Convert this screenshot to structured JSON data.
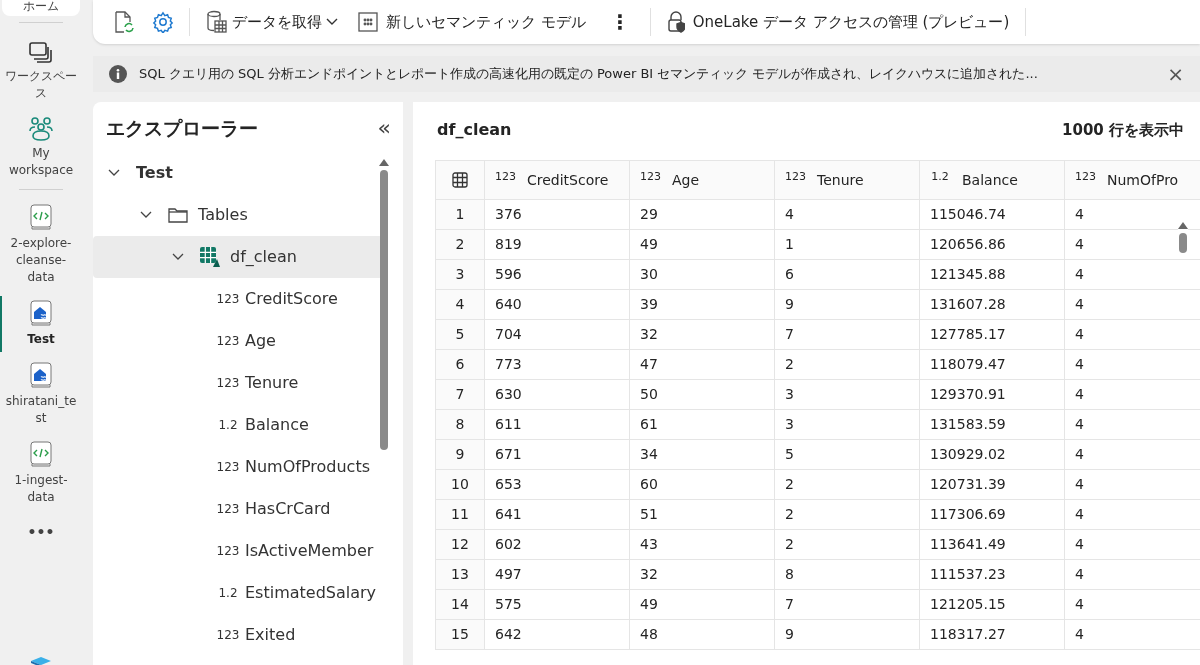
{
  "nav_rail": {
    "top_label": "ホーム",
    "items": [
      {
        "kind": "workspaces",
        "label": "ワークスペース",
        "selected": false
      },
      {
        "kind": "my_workspace",
        "label": "My workspace",
        "selected": false
      },
      {
        "kind": "notebook",
        "label": "2-explore-cleanse-data",
        "selected": false
      },
      {
        "kind": "lakehouse",
        "label": "Test",
        "selected": true
      },
      {
        "kind": "lakehouse",
        "label": "shiratani_test",
        "selected": false
      },
      {
        "kind": "notebook",
        "label": "1-ingest-data",
        "selected": false
      }
    ],
    "more": "•••"
  },
  "toolbar": {
    "items": [
      {
        "kind": "refresh"
      },
      {
        "kind": "settings"
      },
      {
        "kind": "get_data",
        "label": "データを取得"
      },
      {
        "kind": "semantic_model",
        "label": "新しいセマンティック モデル"
      },
      {
        "kind": "more",
        "label": "⋮"
      },
      {
        "kind": "access",
        "label": "OneLake データ アクセスの管理 (プレビュー)"
      }
    ]
  },
  "info_bar": {
    "message": "SQL クエリ用の SQL 分析エンドポイントとレポート作成の高速化用の既定の Power BI セマンティック モデルが作成され、レイクハウスに追加された...",
    "close": "×"
  },
  "explorer": {
    "title": "エクスプローラー",
    "collapse": "«",
    "tree": [
      {
        "label": "Test",
        "kind": "root",
        "expanded": true,
        "selected": false,
        "children": [
          {
            "label": "Tables",
            "kind": "folder",
            "expanded": true,
            "selected": false,
            "children": [
              {
                "label": "df_clean",
                "kind": "table",
                "expanded": true,
                "selected": true,
                "children": [
                  {
                    "label": "CreditScore",
                    "kind": "column",
                    "type_label": "123"
                  },
                  {
                    "label": "Age",
                    "kind": "column",
                    "type_label": "123"
                  },
                  {
                    "label": "Tenure",
                    "kind": "column",
                    "type_label": "123"
                  },
                  {
                    "label": "Balance",
                    "kind": "column",
                    "type_label": "1.2"
                  },
                  {
                    "label": "NumOfProducts",
                    "kind": "column",
                    "type_label": "123"
                  },
                  {
                    "label": "HasCrCard",
                    "kind": "column",
                    "type_label": "123"
                  },
                  {
                    "label": "IsActiveMember",
                    "kind": "column",
                    "type_label": "123"
                  },
                  {
                    "label": "EstimatedSalary",
                    "kind": "column",
                    "type_label": "1.2"
                  },
                  {
                    "label": "Exited",
                    "kind": "column",
                    "type_label": "123"
                  }
                ]
              }
            ]
          }
        ]
      }
    ]
  },
  "preview": {
    "title": "df_clean",
    "row_count": "1000 行を表示中",
    "columns": [
      {
        "type_label": "123",
        "name": "CreditScore"
      },
      {
        "type_label": "123",
        "name": "Age"
      },
      {
        "type_label": "123",
        "name": "Tenure"
      },
      {
        "type_label": "1.2",
        "name": "Balance"
      },
      {
        "type_label": "123",
        "name": "NumOfPro"
      }
    ],
    "rows": [
      {
        "number": "1",
        "cells": [
          "376",
          "29",
          "4",
          "115046.74",
          "4"
        ]
      },
      {
        "number": "2",
        "cells": [
          "819",
          "49",
          "1",
          "120656.86",
          "4"
        ]
      },
      {
        "number": "3",
        "cells": [
          "596",
          "30",
          "6",
          "121345.88",
          "4"
        ]
      },
      {
        "number": "4",
        "cells": [
          "640",
          "39",
          "9",
          "131607.28",
          "4"
        ]
      },
      {
        "number": "5",
        "cells": [
          "704",
          "32",
          "7",
          "127785.17",
          "4"
        ]
      },
      {
        "number": "6",
        "cells": [
          "773",
          "47",
          "2",
          "118079.47",
          "4"
        ]
      },
      {
        "number": "7",
        "cells": [
          "630",
          "50",
          "3",
          "129370.91",
          "4"
        ]
      },
      {
        "number": "8",
        "cells": [
          "611",
          "61",
          "3",
          "131583.59",
          "4"
        ]
      },
      {
        "number": "9",
        "cells": [
          "671",
          "34",
          "5",
          "130929.02",
          "4"
        ]
      },
      {
        "number": "10",
        "cells": [
          "653",
          "60",
          "2",
          "120731.39",
          "4"
        ]
      },
      {
        "number": "11",
        "cells": [
          "641",
          "51",
          "2",
          "117306.69",
          "4"
        ]
      },
      {
        "number": "12",
        "cells": [
          "602",
          "43",
          "2",
          "113641.49",
          "4"
        ]
      },
      {
        "number": "13",
        "cells": [
          "497",
          "32",
          "8",
          "111537.23",
          "4"
        ]
      },
      {
        "number": "14",
        "cells": [
          "575",
          "49",
          "7",
          "121205.15",
          "4"
        ]
      },
      {
        "number": "15",
        "cells": [
          "642",
          "48",
          "9",
          "118317.27",
          "4"
        ]
      }
    ]
  }
}
